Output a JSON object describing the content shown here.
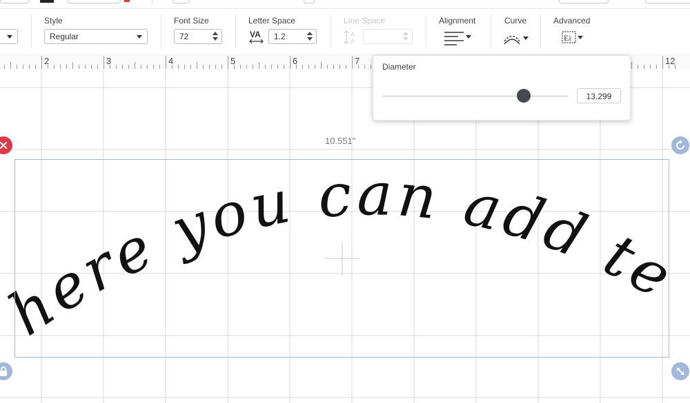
{
  "toolbar": {
    "style": {
      "label": "Style",
      "value": "Regular"
    },
    "font_size": {
      "label": "Font Size",
      "value": "72"
    },
    "letter_space": {
      "label": "Letter Space",
      "value": "1.2"
    },
    "line_space": {
      "label": "Line Space",
      "value": ""
    },
    "alignment": {
      "label": "Alignment"
    },
    "curve": {
      "label": "Curve"
    },
    "advanced": {
      "label": "Advanced"
    }
  },
  "ruler": {
    "numbers": [
      "2",
      "3",
      "4",
      "5",
      "6",
      "7",
      "12"
    ]
  },
  "diameter_popup": {
    "title": "Diameter",
    "value": "13.299",
    "slider_fraction": 0.81
  },
  "selection": {
    "width_label": "10.551\""
  },
  "canvas_text": "here you can add text",
  "colors": {
    "accent_blue": "#9fb8db",
    "delete_red": "#e0394a",
    "grid": "#d8d8d8"
  },
  "icons": [
    "delete-icon",
    "rotate-icon",
    "lock-icon",
    "resize-icon",
    "align-left-icon",
    "curve-icon",
    "advanced-icon",
    "letter-space-icon",
    "line-space-icon"
  ]
}
